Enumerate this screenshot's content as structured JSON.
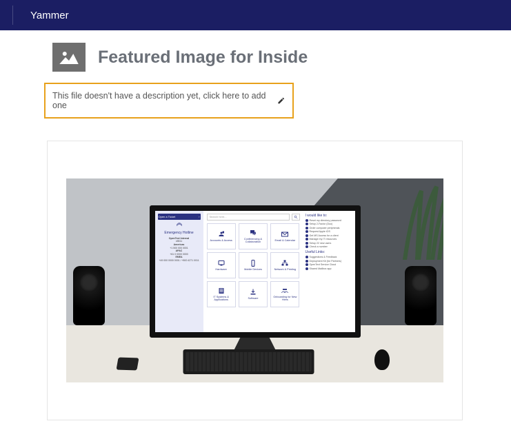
{
  "navbar": {
    "title": "Yammer"
  },
  "header": {
    "title": "Featured Image for Inside"
  },
  "description": {
    "text": "This file doesn't have a description yet, click here to add one"
  },
  "preview": {
    "sidebar": {
      "open_ticket": "Open a Ticket",
      "chevron": "›",
      "emergency_title": "Emergency Hotline",
      "blocks": [
        {
          "label": "OpenText Internal",
          "line": "x5511"
        },
        {
          "label": "Americas",
          "line": "+1 500 000 0001"
        },
        {
          "label": "APAC",
          "line": "+61 0 0000 0000"
        },
        {
          "label": "EMEA",
          "line": "+49 000 0000 0001 / +800 4271 0011"
        }
      ]
    },
    "search": {
      "placeholder": "Search here..."
    },
    "tiles": [
      {
        "label": "Accounts & Access"
      },
      {
        "label": "Conferencing & Collaboration"
      },
      {
        "label": "Email & Calendar"
      },
      {
        "label": "Hardware"
      },
      {
        "label": "Mobile Devices"
      },
      {
        "label": "Network & Printing"
      },
      {
        "label": "IT Systems & Applications"
      },
      {
        "label": "Software"
      },
      {
        "label": "Onboarding for New Hires"
      }
    ],
    "right": {
      "h1": "I would like to:",
      "list1": [
        "Reset my directory password",
        "Setup 2-Factor (Duo)",
        "Order computer peripherals",
        "Request Apple iOS",
        "Get MS Access for a client",
        "Manage my IT resources",
        "Setup 22 new users",
        "Check a number"
      ],
      "h2": "Useful Links:",
      "list2": [
        "Suggestions & Feedback",
        "Deployment Kit (for Partners)",
        "OpenText Service Cloud",
        "Shared Mailbox app"
      ]
    }
  }
}
